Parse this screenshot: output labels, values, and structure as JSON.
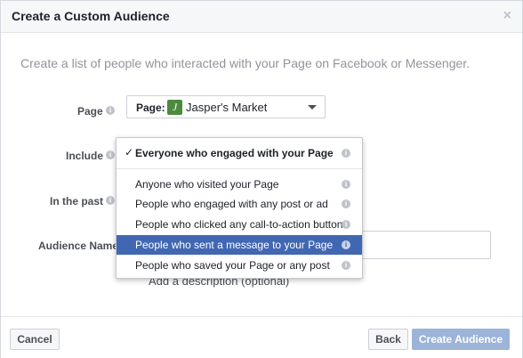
{
  "dialog": {
    "title": "Create a Custom Audience",
    "close_symbol": "×",
    "intro_text": "Create a list of people who interacted with your Page on Facebook or Messenger."
  },
  "form": {
    "page_label": "Page",
    "include_label": "Include",
    "in_the_past_label": "In the past",
    "audience_name_label": "Audience Name",
    "page_select_prefix": "Page:",
    "page_logo_letter": "J",
    "page_select_value": "Jasper's Market",
    "add_description_text": "Add a description (optional)",
    "info_symbol": "i"
  },
  "include_dropdown": {
    "check_symbol": "✓",
    "options": [
      {
        "label": "Everyone who engaged with your Page",
        "checked": true
      },
      {
        "label": "Anyone who visited your Page"
      },
      {
        "label": "People who engaged with any post or ad"
      },
      {
        "label": "People who clicked any call-to-action button"
      },
      {
        "label": "People who sent a message to your Page",
        "highlighted": true
      },
      {
        "label": "People who saved your Page or any post"
      }
    ]
  },
  "footer": {
    "cancel_label": "Cancel",
    "back_label": "Back",
    "create_label": "Create Audience"
  },
  "colors": {
    "highlight": "#4267b2",
    "create_button_disabled": "#9cb4d8",
    "page_logo": "#4c8a3f"
  },
  "icons": [
    "close-icon",
    "info-icon",
    "check-icon",
    "caret-down-icon",
    "page-logo-icon"
  ]
}
